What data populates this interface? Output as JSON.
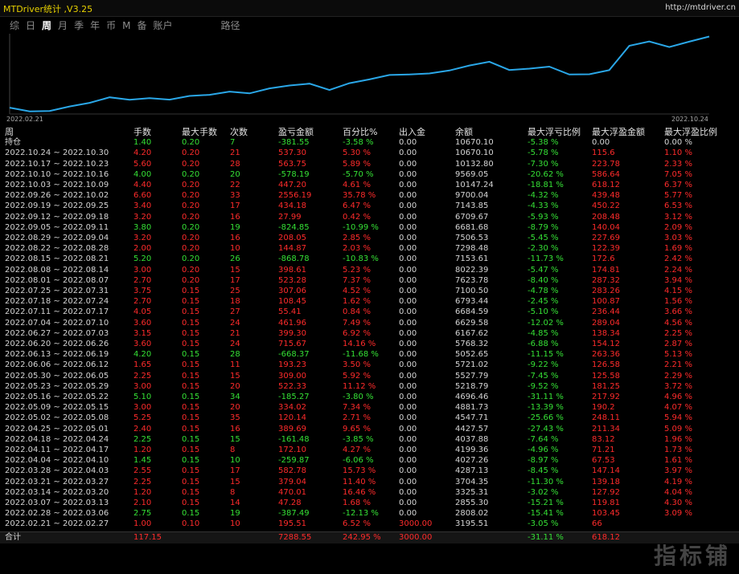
{
  "app_title": "MTDriver统计 ,V3.25",
  "site": "http://mtdriver.cn",
  "tabs": [
    {
      "label": "综",
      "active": false
    },
    {
      "label": "日",
      "active": false
    },
    {
      "label": "周",
      "active": true
    },
    {
      "label": "月",
      "active": false
    },
    {
      "label": "季",
      "active": false
    },
    {
      "label": "年",
      "active": false
    },
    {
      "label": "币",
      "active": false
    },
    {
      "label": "M",
      "active": false
    },
    {
      "label": "备",
      "active": false
    },
    {
      "label": "账户",
      "active": false
    },
    {
      "label": "路径",
      "active": false
    }
  ],
  "chart_data": {
    "type": "line",
    "x": [
      "2022.02.21",
      "2022.02.28",
      "2022.03.07",
      "2022.03.14",
      "2022.03.21",
      "2022.03.28",
      "2022.04.04",
      "2022.04.11",
      "2022.04.18",
      "2022.04.25",
      "2022.05.02",
      "2022.05.09",
      "2022.05.16",
      "2022.05.23",
      "2022.05.30",
      "2022.06.06",
      "2022.06.13",
      "2022.06.20",
      "2022.06.27",
      "2022.07.04",
      "2022.07.11",
      "2022.07.18",
      "2022.07.25",
      "2022.08.01",
      "2022.08.08",
      "2022.08.15",
      "2022.08.22",
      "2022.08.29",
      "2022.09.05",
      "2022.09.12",
      "2022.09.19",
      "2022.09.26",
      "2022.10.03",
      "2022.10.10",
      "2022.10.17",
      "2022.10.24"
    ],
    "values": [
      3195.51,
      2808.02,
      2855.3,
      3325.31,
      3704.35,
      4287.13,
      4027.26,
      4199.36,
      4037.88,
      4427.57,
      4547.71,
      4881.73,
      4696.46,
      5218.79,
      5527.79,
      5721.02,
      5052.65,
      5768.32,
      6167.62,
      6629.58,
      6684.59,
      6793.44,
      7100.5,
      7623.78,
      8022.39,
      7153.61,
      7298.48,
      7506.53,
      6681.68,
      6709.67,
      7143.85,
      9700.04,
      10147.24,
      9569.05,
      10132.8,
      10670.1
    ],
    "x_start_label": "2022.02.21",
    "x_end_label": "2022.10.24",
    "line_color": "#2aa7e8"
  },
  "table": {
    "headers": [
      "周",
      "手数",
      "最大手数",
      "次数",
      "盈亏金额",
      "百分比%",
      "出入金",
      "余额",
      "最大浮亏比例",
      "最大浮盈金额",
      "最大浮盈比例"
    ],
    "holding": {
      "label": "持仓",
      "lots": "1.40",
      "max_lots": "0.20",
      "count": "7",
      "pnl": "-381.55",
      "pct": "-3.58 %",
      "deposit": "0.00",
      "balance": "10670.10",
      "max_dd_pct": "-5.38 %",
      "max_fp_amt": "0.00",
      "max_fp_pct": "0.00 %",
      "sign": "neg"
    },
    "rows": [
      {
        "period": "2022.10.24 ~ 2022.10.30",
        "lots": "4.20",
        "max_lots": "0.20",
        "count": "21",
        "pnl": "537.30",
        "pct": "5.30 %",
        "deposit": "0.00",
        "balance": "10670.10",
        "max_dd_pct": "-5.78 %",
        "max_fp_amt": "115.6",
        "max_fp_pct": "1.10 %",
        "sign": "pos"
      },
      {
        "period": "2022.10.17 ~ 2022.10.23",
        "lots": "5.60",
        "max_lots": "0.20",
        "count": "28",
        "pnl": "563.75",
        "pct": "5.89 %",
        "deposit": "0.00",
        "balance": "10132.80",
        "max_dd_pct": "-7.30 %",
        "max_fp_amt": "223.78",
        "max_fp_pct": "2.33 %",
        "sign": "pos"
      },
      {
        "period": "2022.10.10 ~ 2022.10.16",
        "lots": "4.00",
        "max_lots": "0.20",
        "count": "20",
        "pnl": "-578.19",
        "pct": "-5.70 %",
        "deposit": "0.00",
        "balance": "9569.05",
        "max_dd_pct": "-20.62 %",
        "max_fp_amt": "586.64",
        "max_fp_pct": "7.05 %",
        "sign": "neg"
      },
      {
        "period": "2022.10.03 ~ 2022.10.09",
        "lots": "4.40",
        "max_lots": "0.20",
        "count": "22",
        "pnl": "447.20",
        "pct": "4.61 %",
        "deposit": "0.00",
        "balance": "10147.24",
        "max_dd_pct": "-18.81 %",
        "max_fp_amt": "618.12",
        "max_fp_pct": "6.37 %",
        "sign": "pos"
      },
      {
        "period": "2022.09.26 ~ 2022.10.02",
        "lots": "6.60",
        "max_lots": "0.20",
        "count": "33",
        "pnl": "2556.19",
        "pct": "35.78 %",
        "deposit": "0.00",
        "balance": "9700.04",
        "max_dd_pct": "-4.32 %",
        "max_fp_amt": "439.48",
        "max_fp_pct": "5.77 %",
        "sign": "pos"
      },
      {
        "period": "2022.09.19 ~ 2022.09.25",
        "lots": "3.40",
        "max_lots": "0.20",
        "count": "17",
        "pnl": "434.18",
        "pct": "6.47 %",
        "deposit": "0.00",
        "balance": "7143.85",
        "max_dd_pct": "-4.33 %",
        "max_fp_amt": "450.22",
        "max_fp_pct": "6.53 %",
        "sign": "pos"
      },
      {
        "period": "2022.09.12 ~ 2022.09.18",
        "lots": "3.20",
        "max_lots": "0.20",
        "count": "16",
        "pnl": "27.99",
        "pct": "0.42 %",
        "deposit": "0.00",
        "balance": "6709.67",
        "max_dd_pct": "-5.93 %",
        "max_fp_amt": "208.48",
        "max_fp_pct": "3.12 %",
        "sign": "pos"
      },
      {
        "period": "2022.09.05 ~ 2022.09.11",
        "lots": "3.80",
        "max_lots": "0.20",
        "count": "19",
        "pnl": "-824.85",
        "pct": "-10.99 %",
        "deposit": "0.00",
        "balance": "6681.68",
        "max_dd_pct": "-8.79 %",
        "max_fp_amt": "140.04",
        "max_fp_pct": "2.09 %",
        "sign": "neg"
      },
      {
        "period": "2022.08.29 ~ 2022.09.04",
        "lots": "3.20",
        "max_lots": "0.20",
        "count": "16",
        "pnl": "208.05",
        "pct": "2.85 %",
        "deposit": "0.00",
        "balance": "7506.53",
        "max_dd_pct": "-5.45 %",
        "max_fp_amt": "227.69",
        "max_fp_pct": "3.03 %",
        "sign": "pos"
      },
      {
        "period": "2022.08.22 ~ 2022.08.28",
        "lots": "2.00",
        "max_lots": "0.20",
        "count": "10",
        "pnl": "144.87",
        "pct": "2.03 %",
        "deposit": "0.00",
        "balance": "7298.48",
        "max_dd_pct": "-2.30 %",
        "max_fp_amt": "122.39",
        "max_fp_pct": "1.69 %",
        "sign": "pos"
      },
      {
        "period": "2022.08.15 ~ 2022.08.21",
        "lots": "5.20",
        "max_lots": "0.20",
        "count": "26",
        "pnl": "-868.78",
        "pct": "-10.83 %",
        "deposit": "0.00",
        "balance": "7153.61",
        "max_dd_pct": "-11.73 %",
        "max_fp_amt": "172.6",
        "max_fp_pct": "2.42 %",
        "sign": "neg"
      },
      {
        "period": "2022.08.08 ~ 2022.08.14",
        "lots": "3.00",
        "max_lots": "0.20",
        "count": "15",
        "pnl": "398.61",
        "pct": "5.23 %",
        "deposit": "0.00",
        "balance": "8022.39",
        "max_dd_pct": "-5.47 %",
        "max_fp_amt": "174.81",
        "max_fp_pct": "2.24 %",
        "sign": "pos"
      },
      {
        "period": "2022.08.01 ~ 2022.08.07",
        "lots": "2.70",
        "max_lots": "0.20",
        "count": "17",
        "pnl": "523.28",
        "pct": "7.37 %",
        "deposit": "0.00",
        "balance": "7623.78",
        "max_dd_pct": "-8.40 %",
        "max_fp_amt": "287.32",
        "max_fp_pct": "3.94 %",
        "sign": "pos"
      },
      {
        "period": "2022.07.25 ~ 2022.07.31",
        "lots": "3.75",
        "max_lots": "0.15",
        "count": "25",
        "pnl": "307.06",
        "pct": "4.52 %",
        "deposit": "0.00",
        "balance": "7100.50",
        "max_dd_pct": "-4.78 %",
        "max_fp_amt": "283.26",
        "max_fp_pct": "4.15 %",
        "sign": "pos"
      },
      {
        "period": "2022.07.18 ~ 2022.07.24",
        "lots": "2.70",
        "max_lots": "0.15",
        "count": "18",
        "pnl": "108.45",
        "pct": "1.62 %",
        "deposit": "0.00",
        "balance": "6793.44",
        "max_dd_pct": "-2.45 %",
        "max_fp_amt": "100.87",
        "max_fp_pct": "1.56 %",
        "sign": "pos"
      },
      {
        "period": "2022.07.11 ~ 2022.07.17",
        "lots": "4.05",
        "max_lots": "0.15",
        "count": "27",
        "pnl": "55.41",
        "pct": "0.84 %",
        "deposit": "0.00",
        "balance": "6684.59",
        "max_dd_pct": "-5.10 %",
        "max_fp_amt": "236.44",
        "max_fp_pct": "3.66 %",
        "sign": "pos"
      },
      {
        "period": "2022.07.04 ~ 2022.07.10",
        "lots": "3.60",
        "max_lots": "0.15",
        "count": "24",
        "pnl": "461.96",
        "pct": "7.49 %",
        "deposit": "0.00",
        "balance": "6629.58",
        "max_dd_pct": "-12.02 %",
        "max_fp_amt": "289.04",
        "max_fp_pct": "4.56 %",
        "sign": "pos"
      },
      {
        "period": "2022.06.27 ~ 2022.07.03",
        "lots": "3.15",
        "max_lots": "0.15",
        "count": "21",
        "pnl": "399.30",
        "pct": "6.92 %",
        "deposit": "0.00",
        "balance": "6167.62",
        "max_dd_pct": "-4.85 %",
        "max_fp_amt": "138.34",
        "max_fp_pct": "2.25 %",
        "sign": "pos"
      },
      {
        "period": "2022.06.20 ~ 2022.06.26",
        "lots": "3.60",
        "max_lots": "0.15",
        "count": "24",
        "pnl": "715.67",
        "pct": "14.16 %",
        "deposit": "0.00",
        "balance": "5768.32",
        "max_dd_pct": "-6.88 %",
        "max_fp_amt": "154.12",
        "max_fp_pct": "2.87 %",
        "sign": "pos"
      },
      {
        "period": "2022.06.13 ~ 2022.06.19",
        "lots": "4.20",
        "max_lots": "0.15",
        "count": "28",
        "pnl": "-668.37",
        "pct": "-11.68 %",
        "deposit": "0.00",
        "balance": "5052.65",
        "max_dd_pct": "-11.15 %",
        "max_fp_amt": "263.36",
        "max_fp_pct": "5.13 %",
        "sign": "neg"
      },
      {
        "period": "2022.06.06 ~ 2022.06.12",
        "lots": "1.65",
        "max_lots": "0.15",
        "count": "11",
        "pnl": "193.23",
        "pct": "3.50 %",
        "deposit": "0.00",
        "balance": "5721.02",
        "max_dd_pct": "-9.22 %",
        "max_fp_amt": "126.58",
        "max_fp_pct": "2.21 %",
        "sign": "pos"
      },
      {
        "period": "2022.05.30 ~ 2022.06.05",
        "lots": "2.25",
        "max_lots": "0.15",
        "count": "15",
        "pnl": "309.00",
        "pct": "5.92 %",
        "deposit": "0.00",
        "balance": "5527.79",
        "max_dd_pct": "-7.45 %",
        "max_fp_amt": "125.58",
        "max_fp_pct": "2.29 %",
        "sign": "pos"
      },
      {
        "period": "2022.05.23 ~ 2022.05.29",
        "lots": "3.00",
        "max_lots": "0.15",
        "count": "20",
        "pnl": "522.33",
        "pct": "11.12 %",
        "deposit": "0.00",
        "balance": "5218.79",
        "max_dd_pct": "-9.52 %",
        "max_fp_amt": "181.25",
        "max_fp_pct": "3.72 %",
        "sign": "pos"
      },
      {
        "period": "2022.05.16 ~ 2022.05.22",
        "lots": "5.10",
        "max_lots": "0.15",
        "count": "34",
        "pnl": "-185.27",
        "pct": "-3.80 %",
        "deposit": "0.00",
        "balance": "4696.46",
        "max_dd_pct": "-31.11 %",
        "max_fp_amt": "217.92",
        "max_fp_pct": "4.96 %",
        "sign": "neg"
      },
      {
        "period": "2022.05.09 ~ 2022.05.15",
        "lots": "3.00",
        "max_lots": "0.15",
        "count": "20",
        "pnl": "334.02",
        "pct": "7.34 %",
        "deposit": "0.00",
        "balance": "4881.73",
        "max_dd_pct": "-13.39 %",
        "max_fp_amt": "190.2",
        "max_fp_pct": "4.07 %",
        "sign": "pos"
      },
      {
        "period": "2022.05.02 ~ 2022.05.08",
        "lots": "5.25",
        "max_lots": "0.15",
        "count": "35",
        "pnl": "120.14",
        "pct": "2.71 %",
        "deposit": "0.00",
        "balance": "4547.71",
        "max_dd_pct": "-25.66 %",
        "max_fp_amt": "248.11",
        "max_fp_pct": "5.94 %",
        "sign": "pos"
      },
      {
        "period": "2022.04.25 ~ 2022.05.01",
        "lots": "2.40",
        "max_lots": "0.15",
        "count": "16",
        "pnl": "389.69",
        "pct": "9.65 %",
        "deposit": "0.00",
        "balance": "4427.57",
        "max_dd_pct": "-27.43 %",
        "max_fp_amt": "211.34",
        "max_fp_pct": "5.09 %",
        "sign": "pos"
      },
      {
        "period": "2022.04.18 ~ 2022.04.24",
        "lots": "2.25",
        "max_lots": "0.15",
        "count": "15",
        "pnl": "-161.48",
        "pct": "-3.85 %",
        "deposit": "0.00",
        "balance": "4037.88",
        "max_dd_pct": "-7.64 %",
        "max_fp_amt": "83.12",
        "max_fp_pct": "1.96 %",
        "sign": "neg"
      },
      {
        "period": "2022.04.11 ~ 2022.04.17",
        "lots": "1.20",
        "max_lots": "0.15",
        "count": "8",
        "pnl": "172.10",
        "pct": "4.27 %",
        "deposit": "0.00",
        "balance": "4199.36",
        "max_dd_pct": "-4.96 %",
        "max_fp_amt": "71.21",
        "max_fp_pct": "1.73 %",
        "sign": "pos"
      },
      {
        "period": "2022.04.04 ~ 2022.04.10",
        "lots": "1.45",
        "max_lots": "0.15",
        "count": "10",
        "pnl": "-259.87",
        "pct": "-6.06 %",
        "deposit": "0.00",
        "balance": "4027.26",
        "max_dd_pct": "-8.97 %",
        "max_fp_amt": "67.53",
        "max_fp_pct": "1.61 %",
        "sign": "neg"
      },
      {
        "period": "2022.03.28 ~ 2022.04.03",
        "lots": "2.55",
        "max_lots": "0.15",
        "count": "17",
        "pnl": "582.78",
        "pct": "15.73 %",
        "deposit": "0.00",
        "balance": "4287.13",
        "max_dd_pct": "-8.45 %",
        "max_fp_amt": "147.14",
        "max_fp_pct": "3.97 %",
        "sign": "pos"
      },
      {
        "period": "2022.03.21 ~ 2022.03.27",
        "lots": "2.25",
        "max_lots": "0.15",
        "count": "15",
        "pnl": "379.04",
        "pct": "11.40 %",
        "deposit": "0.00",
        "balance": "3704.35",
        "max_dd_pct": "-11.30 %",
        "max_fp_amt": "139.18",
        "max_fp_pct": "4.19 %",
        "sign": "pos"
      },
      {
        "period": "2022.03.14 ~ 2022.03.20",
        "lots": "1.20",
        "max_lots": "0.15",
        "count": "8",
        "pnl": "470.01",
        "pct": "16.46 %",
        "deposit": "0.00",
        "balance": "3325.31",
        "max_dd_pct": "-3.02 %",
        "max_fp_amt": "127.92",
        "max_fp_pct": "4.04 %",
        "sign": "pos"
      },
      {
        "period": "2022.03.07 ~ 2022.03.13",
        "lots": "2.10",
        "max_lots": "0.15",
        "count": "14",
        "pnl": "47.28",
        "pct": "1.68 %",
        "deposit": "0.00",
        "balance": "2855.30",
        "max_dd_pct": "-15.21 %",
        "max_fp_amt": "119.81",
        "max_fp_pct": "4.30 %",
        "sign": "pos"
      },
      {
        "period": "2022.02.28 ~ 2022.03.06",
        "lots": "2.75",
        "max_lots": "0.15",
        "count": "19",
        "pnl": "-387.49",
        "pct": "-12.13 %",
        "deposit": "0.00",
        "balance": "2808.02",
        "max_dd_pct": "-15.41 %",
        "max_fp_amt": "103.45",
        "max_fp_pct": "3.09 %",
        "sign": "neg"
      },
      {
        "period": "2022.02.21 ~ 2022.02.27",
        "lots": "1.00",
        "max_lots": "0.10",
        "count": "10",
        "pnl": "195.51",
        "pct": "6.52 %",
        "deposit": "3000.00",
        "balance": "3195.51",
        "max_dd_pct": "-3.05 %",
        "max_fp_amt": "66",
        "max_fp_pct": "",
        "sign": "pos"
      }
    ],
    "totals": {
      "label": "合计",
      "lots": "117.15",
      "pnl": "7288.55",
      "pct": "242.95 %",
      "deposit": "3000.00",
      "max_dd_pct": "-31.11 %",
      "max_fp_amt": "618.12"
    }
  },
  "watermark": "指标铺",
  "colors": {
    "positive": "#ff2b2b",
    "negative": "#35e035",
    "neutral": "#d5d5d5",
    "line": "#2aa7e8",
    "title": "#e7d000"
  }
}
